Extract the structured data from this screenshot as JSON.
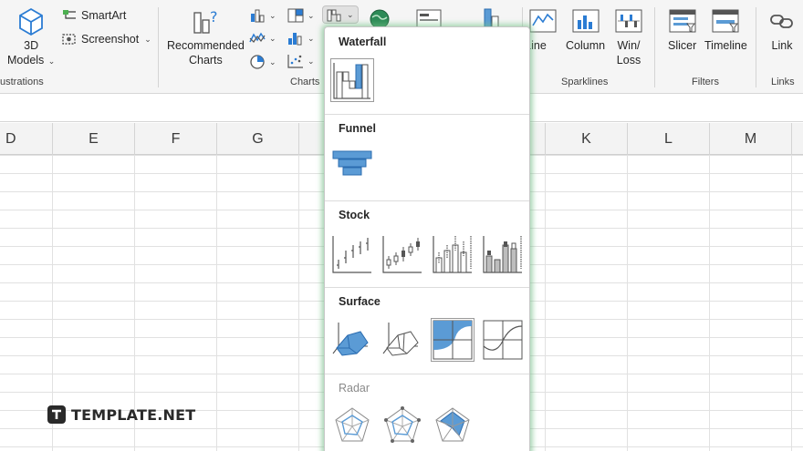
{
  "ribbon": {
    "illustrations": {
      "models_label_1": "3D",
      "models_label_2": "Models",
      "smartart_label": "SmartArt",
      "screenshot_label": "Screenshot",
      "group_label": "ustrations"
    },
    "charts": {
      "recommended_label_1": "Recommended",
      "recommended_label_2": "Charts",
      "group_label": "Charts"
    },
    "sparklines": {
      "line_label": "Line",
      "column_label": "Column",
      "winloss_label_1": "Win/",
      "winloss_label_2": "Loss",
      "group_label": "Sparklines"
    },
    "filters": {
      "slicer_label": "Slicer",
      "timeline_label": "Timeline",
      "group_label": "Filters"
    },
    "links": {
      "link_label": "Link",
      "group_label": "Links"
    }
  },
  "columns": [
    "D",
    "E",
    "F",
    "G",
    "K",
    "L",
    "M"
  ],
  "dropdown": {
    "sections": [
      {
        "title": "Waterfall",
        "icons": [
          "waterfall-chart-icon"
        ]
      },
      {
        "title": "Funnel",
        "icons": [
          "funnel-chart-icon"
        ]
      },
      {
        "title": "Stock",
        "icons": [
          "stock-hlc-icon",
          "stock-ohlc-icon",
          "stock-vhlc-icon",
          "stock-vohlc-icon"
        ]
      },
      {
        "title": "Surface",
        "icons": [
          "surface-3d-icon",
          "surface-wireframe-icon",
          "contour-icon",
          "contour-wireframe-icon"
        ]
      },
      {
        "title": "Radar",
        "icons": [
          "radar-icon",
          "radar-markers-icon",
          "filled-radar-icon"
        ]
      }
    ]
  },
  "watermark": {
    "text": "TEMPLATE.NET"
  },
  "colors": {
    "accent_blue": "#5b9bd5",
    "chart_blue": "#4a90d9",
    "glow": "#7cc896"
  }
}
